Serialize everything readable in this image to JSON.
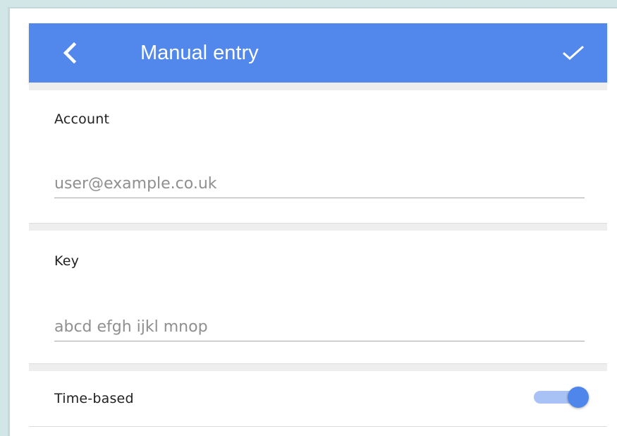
{
  "app_bar": {
    "title": "Manual entry",
    "back_icon": "chevron-left-icon",
    "done_icon": "checkmark-icon",
    "color": "#5287ec"
  },
  "account": {
    "label": "Account",
    "value": "",
    "placeholder": "user@example.co.uk"
  },
  "key": {
    "label": "Key",
    "value": "",
    "placeholder": "abcd efgh ijkl mnop"
  },
  "time_based": {
    "label": "Time-based",
    "enabled": true,
    "track_color": "#a9c2f5",
    "thumb_color": "#4f86ec"
  }
}
